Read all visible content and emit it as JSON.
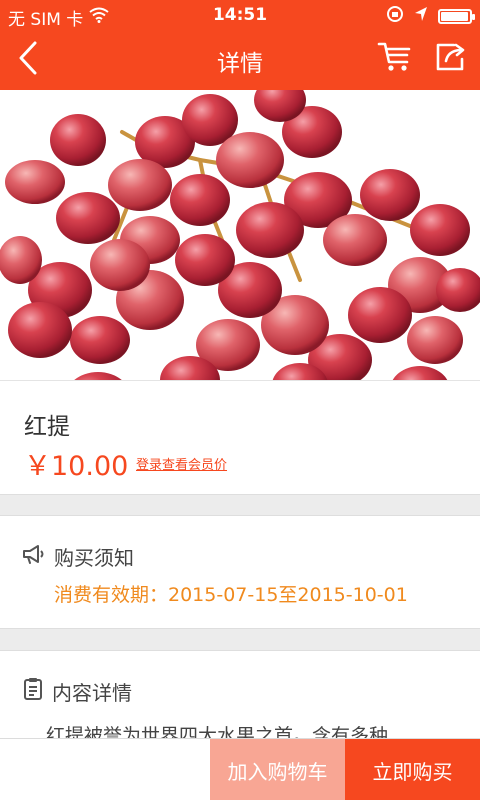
{
  "status_bar": {
    "carrier": "无 SIM 卡",
    "time": "14:51",
    "battery_level": 0.95
  },
  "nav": {
    "title": "详情",
    "icons": [
      "back-arrow-icon",
      "cart-icon",
      "share-icon"
    ]
  },
  "product": {
    "image": "red-grapes",
    "name": "红提",
    "price": "￥10.00",
    "member_price_link": "登录查看会员价"
  },
  "notice": {
    "title": "购买须知",
    "validity": "消费有效期：2015-07-15至2015-10-01"
  },
  "details": {
    "title": "内容详情",
    "text": "红提被誉为世界四大水果之首。含有多种"
  },
  "actions": {
    "add_to_cart": "加入购物车",
    "buy_now": "立即购买"
  },
  "colors": {
    "brand": "#f6481f",
    "accent_orange": "#f08a1e",
    "add_cart_bg": "#f8a694"
  }
}
